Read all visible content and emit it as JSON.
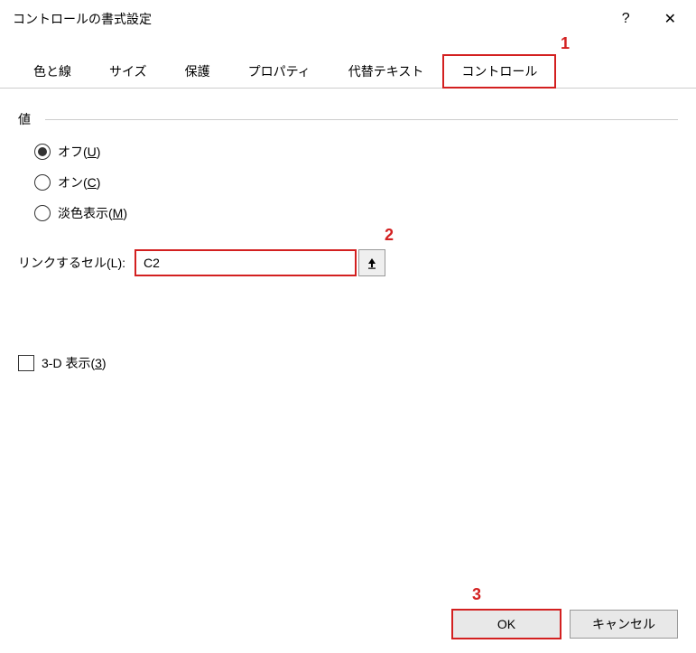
{
  "titlebar": {
    "title": "コントロールの書式設定",
    "help": "?",
    "close": "✕"
  },
  "tabs": {
    "colors_lines": "色と線",
    "size": "サイズ",
    "protect": "保護",
    "properties": "プロパティ",
    "alt_text": "代替テキスト",
    "control": "コントロール"
  },
  "callouts": {
    "one": "1",
    "two": "2",
    "three": "3"
  },
  "value_group": {
    "label": "値",
    "off_prefix": "オフ(",
    "off_key": "U",
    "off_suffix": ")",
    "on_prefix": "オン(",
    "on_key": "C",
    "on_suffix": ")",
    "mixed_prefix": "淡色表示(",
    "mixed_key": "M",
    "mixed_suffix": ")"
  },
  "link_cell": {
    "label_prefix": "リンクするセル(",
    "label_key": "L",
    "label_suffix": "):",
    "value": "C2"
  },
  "three_d": {
    "label_prefix": "3-D 表示(",
    "label_key": "3",
    "label_suffix": ")"
  },
  "footer": {
    "ok": "OK",
    "cancel": "キャンセル"
  }
}
